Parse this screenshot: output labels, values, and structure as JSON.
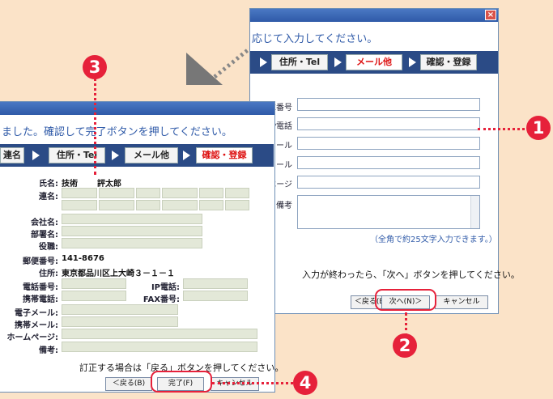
{
  "right_window": {
    "instruction": "応じて入力してください。",
    "steps": [
      "住所・Tel",
      "メール他",
      "確認・登録"
    ],
    "active_step": "メール他",
    "fields": [
      "FAX番号",
      "IP電話",
      "電子メール",
      "携帯メール",
      "ホームページ",
      "備考"
    ],
    "note": "（全角で約25文字入力できます。）",
    "hint": "入力が終わったら、「次へ」ボタンを押してください。",
    "buttons": {
      "back": "＜戻る(B)",
      "next": "次へ(N)＞",
      "cancel": "キャンセル"
    }
  },
  "left_window": {
    "instruction": "ました。確認して完了ボタンを押してください。",
    "steps": [
      "連名",
      "住所・Tel",
      "メール他",
      "確認・登録"
    ],
    "active_step": "確認・登録",
    "labels": {
      "name": "氏名:",
      "renmei": "連名:",
      "company": "会社名:",
      "dept": "部署名:",
      "title": "役職:",
      "zip": "郵便番号:",
      "address": "住所:",
      "tel": "電話番号:",
      "ip": "IP電話:",
      "mobile": "携帯電話:",
      "fax": "FAX番号:",
      "email": "電子メール:",
      "mobile_mail": "携帯メール:",
      "homepage": "ホームページ:",
      "memo": "備考:"
    },
    "values": {
      "last_name": "技術",
      "first_name": "評太郎",
      "zip": "141-8676",
      "address": "東京都品川区上大崎３－１－１"
    },
    "hint": "訂正する場合は「戻る」ボタンを押してください。",
    "buttons": {
      "back": "＜戻る(B)",
      "finish": "完了(F)",
      "cancel": "キャンセル"
    }
  },
  "badges": [
    "1",
    "2",
    "3",
    "4"
  ],
  "colors": {
    "accent": "#e6213a",
    "background": "#fbe3c8",
    "stepbar": "#2b4b86"
  }
}
